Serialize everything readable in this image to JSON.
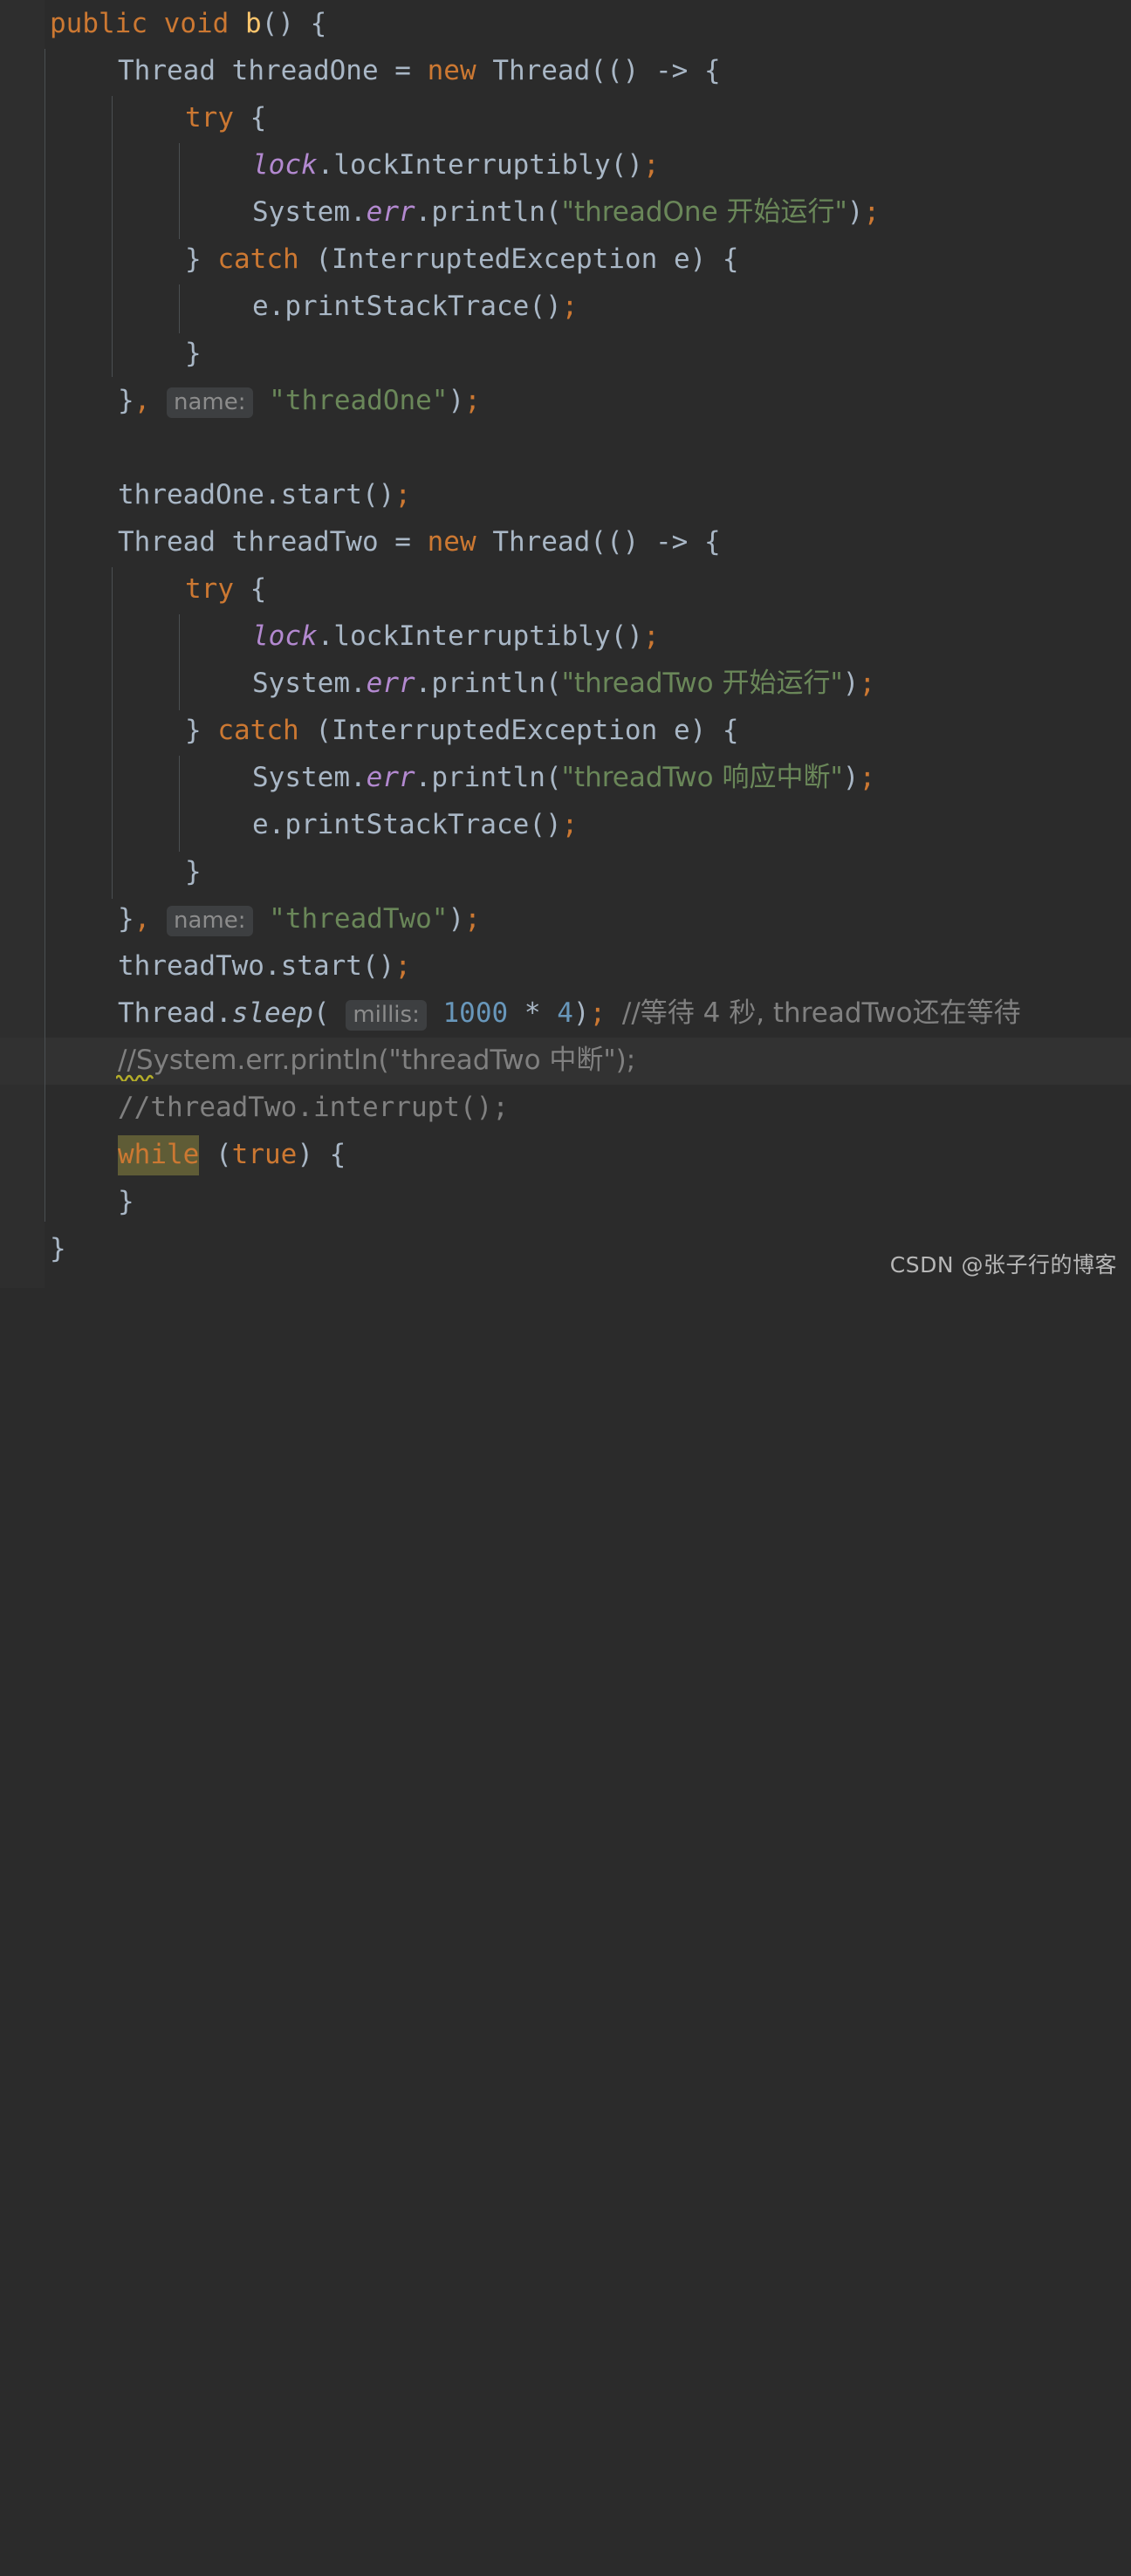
{
  "editor": {
    "theme": "darcula",
    "background": "#2b2b2b",
    "gutter_background": "#2e2e2e",
    "current_line_background": "#323232",
    "indent_guide_color": "#4b4f52",
    "colors": {
      "keyword": "#cc7832",
      "identifier": "#a9b7c6",
      "method_declaration": "#ffc66d",
      "field_italic": "#b389d0",
      "string": "#6a8759",
      "number": "#6897bb",
      "comment": "#808080",
      "hint_chip_background": "#3d3f41",
      "hint_chip_text": "#8c8c8c",
      "search_match_background": "#5f5c36",
      "warning_squiggle": "#bbb529"
    },
    "current_line_number": 25,
    "lines": [
      {
        "n": 1,
        "indent": 0,
        "text": "public void b() {"
      },
      {
        "n": 2,
        "indent": 1,
        "text": "Thread threadOne = new Thread(() -> {"
      },
      {
        "n": 3,
        "indent": 2,
        "text": "try {"
      },
      {
        "n": 4,
        "indent": 3,
        "text": "lock.lockInterruptibly();"
      },
      {
        "n": 5,
        "indent": 3,
        "text": "System.err.println(\"threadOne 开始运行\");"
      },
      {
        "n": 6,
        "indent": 2,
        "text": "} catch (InterruptedException e) {"
      },
      {
        "n": 7,
        "indent": 3,
        "text": "e.printStackTrace();"
      },
      {
        "n": 8,
        "indent": 2,
        "text": "}"
      },
      {
        "n": 9,
        "indent": 1,
        "text": "}, name: \"threadOne\");"
      },
      {
        "n": 10,
        "indent": 0,
        "text": ""
      },
      {
        "n": 11,
        "indent": 1,
        "text": "threadOne.start();"
      },
      {
        "n": 12,
        "indent": 1,
        "text": "Thread threadTwo = new Thread(() -> {"
      },
      {
        "n": 13,
        "indent": 2,
        "text": "try {"
      },
      {
        "n": 14,
        "indent": 3,
        "text": "lock.lockInterruptibly();"
      },
      {
        "n": 15,
        "indent": 3,
        "text": "System.err.println(\"threadTwo 开始运行\");"
      },
      {
        "n": 16,
        "indent": 2,
        "text": "} catch (InterruptedException e) {"
      },
      {
        "n": 17,
        "indent": 3,
        "text": "System.err.println(\"threadTwo 响应中断\");"
      },
      {
        "n": 18,
        "indent": 3,
        "text": "e.printStackTrace();"
      },
      {
        "n": 19,
        "indent": 2,
        "text": "}"
      },
      {
        "n": 20,
        "indent": 1,
        "text": "}, name: \"threadTwo\");"
      },
      {
        "n": 21,
        "indent": 1,
        "text": "threadTwo.start();"
      },
      {
        "n": 22,
        "indent": 1,
        "text": "Thread.sleep( millis: 1000 * 4); //等待 4 秒, threadTwo还在等待"
      },
      {
        "n": 23,
        "indent": 1,
        "text": "//System.err.println(\"threadTwo 中断\");"
      },
      {
        "n": 24,
        "indent": 1,
        "text": "//threadTwo.interrupt();"
      },
      {
        "n": 25,
        "indent": 1,
        "text": "while (true) {"
      },
      {
        "n": 26,
        "indent": 1,
        "text": "}"
      },
      {
        "n": 27,
        "indent": 0,
        "text": "}"
      }
    ]
  },
  "tokens": {
    "kw_public": "public",
    "kw_void": "void",
    "kw_new": "new",
    "kw_try": "try",
    "kw_catch": "catch",
    "kw_while": "while",
    "kw_true": "true",
    "method_b": "b",
    "type_thread": "Thread",
    "type_interrupted_exception": "InterruptedException",
    "var_thread_one": "threadOne",
    "var_thread_two": "threadTwo",
    "var_e": "e",
    "field_lock": "lock",
    "field_err": "err",
    "class_system": "System",
    "mth_lock_interruptibly": "lockInterruptibly",
    "mth_println": "println",
    "mth_print_stack_trace": "printStackTrace",
    "mth_start": "start",
    "mth_sleep": "sleep",
    "mth_interrupt": "interrupt",
    "lambda_arrow": "->",
    "num_1000": "1000",
    "num_4": "4",
    "op_star": "*"
  },
  "hints": {
    "name_hint": "name:",
    "millis_hint": "millis:"
  },
  "strings": {
    "s_thread_one_name": "\"threadOne\"",
    "s_thread_two_name": "\"threadTwo\"",
    "s_thread_one_start": "\"threadOne 开始运行\"",
    "s_thread_two_start": "\"threadTwo 开始运行\"",
    "s_thread_two_interrupted": "\"threadTwo 响应中断\"",
    "s_thread_two_break": "\"threadTwo 中断\""
  },
  "comments": {
    "wait_comment": "//等待 4 秒, threadTwo还在等待",
    "commented_println": "//System.err.println(\"threadTwo 中断\");",
    "commented_interrupt": "//threadTwo.interrupt();"
  },
  "watermark": {
    "text": "CSDN @张子行的博客"
  }
}
